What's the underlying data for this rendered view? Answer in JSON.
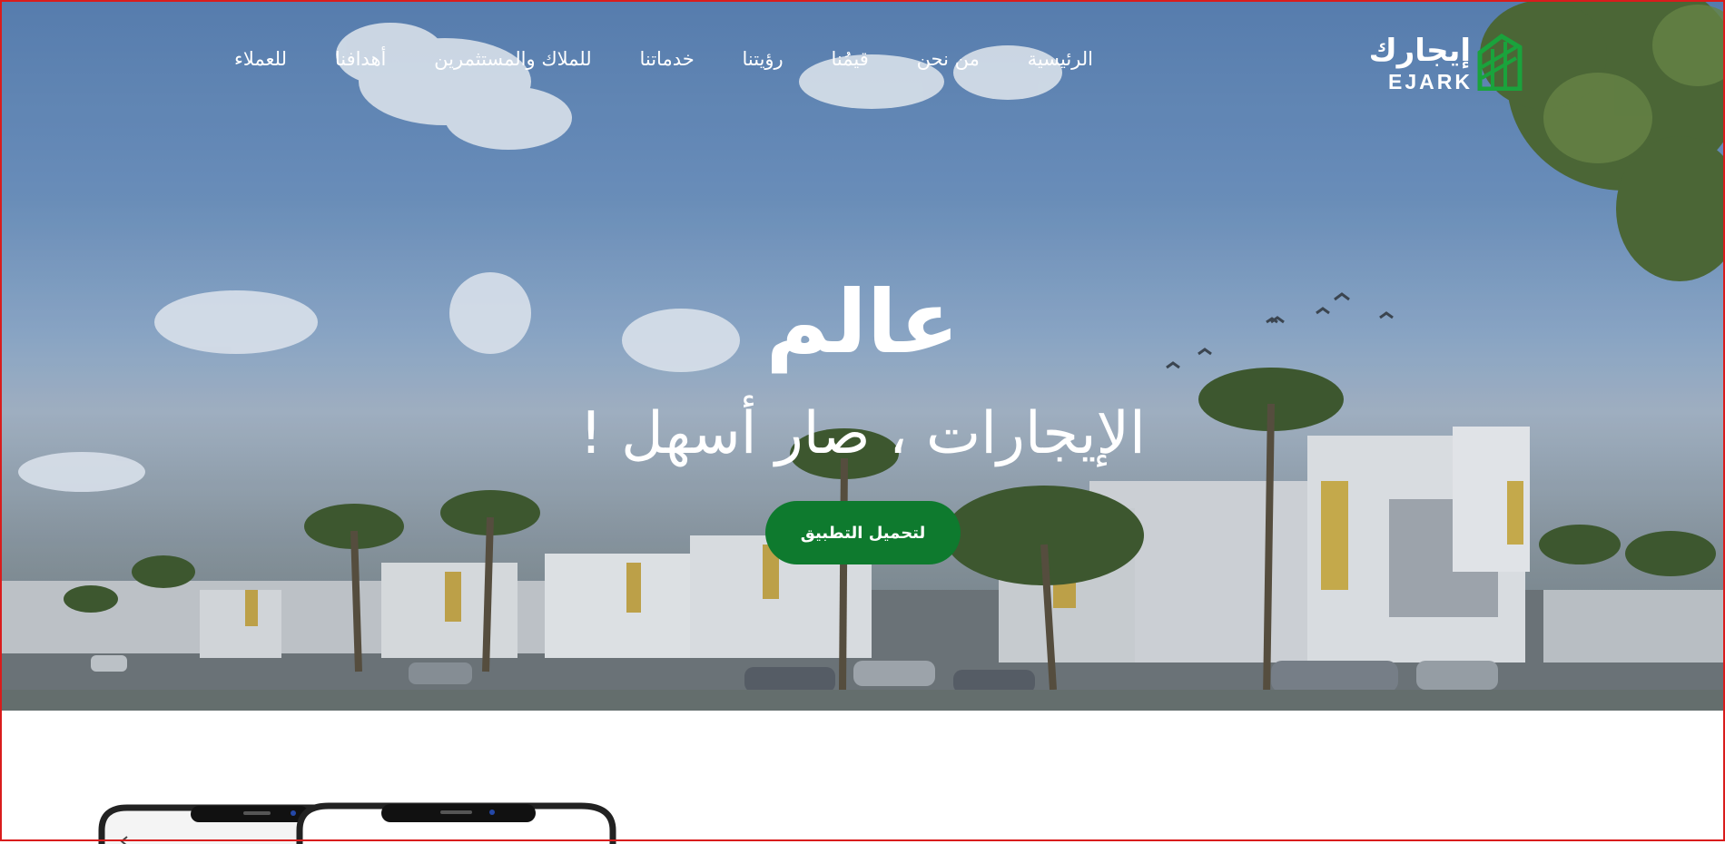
{
  "brand": {
    "name_ar": "إيجارك",
    "name_en": "EJARK",
    "accent_color": "#1aa33c"
  },
  "nav": {
    "items": [
      {
        "label": "الرئيسية"
      },
      {
        "label": "من نحن"
      },
      {
        "label": "قيمُنا"
      },
      {
        "label": "رؤيتنا"
      },
      {
        "label": "خدماتنا"
      },
      {
        "label": "للملاك والمستثمرين"
      },
      {
        "label": "أهدافنا"
      },
      {
        "label": "للعملاء"
      }
    ]
  },
  "hero": {
    "title": "عالم",
    "subtitle": "الإيجارات ، صار أسهل !",
    "cta_label": "لتحميل التطبيق",
    "cta_color": "#0e7a2e"
  }
}
